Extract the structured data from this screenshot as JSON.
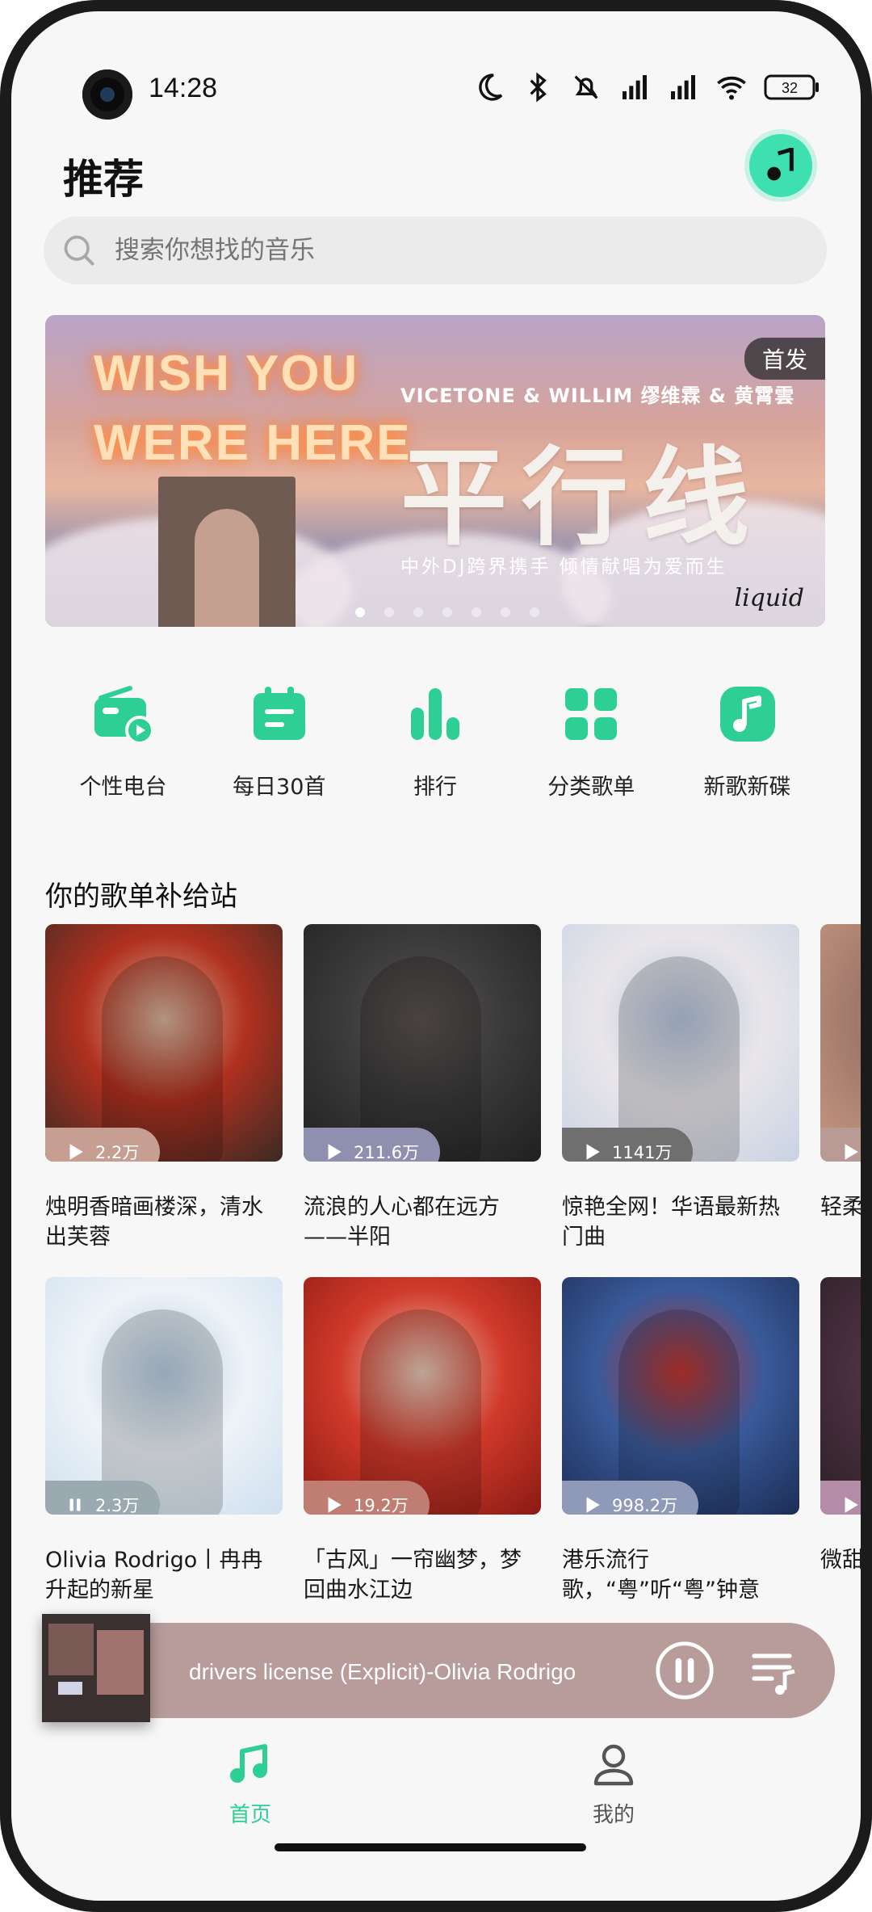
{
  "status_bar": {
    "time": "14:28",
    "battery": "32"
  },
  "header": {
    "title": "推荐"
  },
  "search": {
    "placeholder": "搜索你想找的音乐"
  },
  "banner": {
    "neon_line1": "WISH YOU",
    "neon_line2": "WERE HERE",
    "artists": "VICETONE & WILLIM 缪维霖 & 黄霄雲",
    "title": "平行线",
    "subtitle": "中外DJ跨界携手 倾情献唱为爱而生",
    "badge": "首发",
    "logo": "liquid",
    "dots_count": 7,
    "active_dot": 0
  },
  "quick_nav": [
    {
      "label": "个性电台",
      "icon": "radio-icon"
    },
    {
      "label": "每日30首",
      "icon": "calendar-icon"
    },
    {
      "label": "排行",
      "icon": "chart-bars-icon"
    },
    {
      "label": "分类歌单",
      "icon": "grid-icon"
    },
    {
      "label": "新歌新碟",
      "icon": "music-note-icon"
    }
  ],
  "section": {
    "title": "你的歌单补给站"
  },
  "playlists": [
    {
      "title": "烛明香暗画楼深，清水出芙蓉",
      "plays": "2.2万",
      "state": "play",
      "badge_color": "#c79e92",
      "cover": [
        "#3a2a24",
        "#b0301f",
        "#d9b59c"
      ]
    },
    {
      "title": "流浪的人心都在远方——半阳",
      "plays": "211.6万",
      "state": "play",
      "badge_color": "#8f8fb0",
      "cover": [
        "#202020",
        "#3a3a3a",
        "#5a5350"
      ]
    },
    {
      "title": "惊艳全网！华语最新热门曲",
      "plays": "1141万",
      "state": "play",
      "badge_color": "#6f6f6f",
      "cover": [
        "#c9d3e3",
        "#e9e6ea",
        "#b6c5dc"
      ]
    },
    {
      "title": "轻柔不止",
      "plays": "",
      "state": "play",
      "badge_color": "#b99a95",
      "cover": [
        "#c99a83",
        "#a0786a",
        "#d7b8a4"
      ]
    },
    {
      "title": "Olivia Rodrigo丨冉冉升起的新星",
      "plays": "2.3万",
      "state": "pause",
      "badge_color": "#9aaab0",
      "cover": [
        "#cfe0ef",
        "#eef3f8",
        "#b8cde0"
      ]
    },
    {
      "title": "「古风」一帘幽梦，梦回曲水江边",
      "plays": "19.2万",
      "state": "play",
      "badge_color": "#c07e72",
      "cover": [
        "#8a1a14",
        "#d13a2a",
        "#e8c9b8"
      ]
    },
    {
      "title": "港乐流行歌，“粤”听“粤”钟意",
      "plays": "998.2万",
      "state": "play",
      "badge_color": "#8e9ab8",
      "cover": [
        "#1b2d55",
        "#3a5a9a",
        "#c0362f"
      ]
    },
    {
      "title": "微甜舞",
      "plays": "",
      "state": "play",
      "badge_color": "#b58ca8",
      "cover": [
        "#2a1e24",
        "#4a3040",
        "#6a4a60"
      ]
    }
  ],
  "mini_player": {
    "title": "drivers license (Explicit)-Olivia Rodrigo"
  },
  "bottom_nav": {
    "home": {
      "label": "首页",
      "active": true
    },
    "mine": {
      "label": "我的",
      "active": false
    }
  },
  "colors": {
    "accent": "#2ecf94",
    "player_bg": "#b79c99"
  }
}
